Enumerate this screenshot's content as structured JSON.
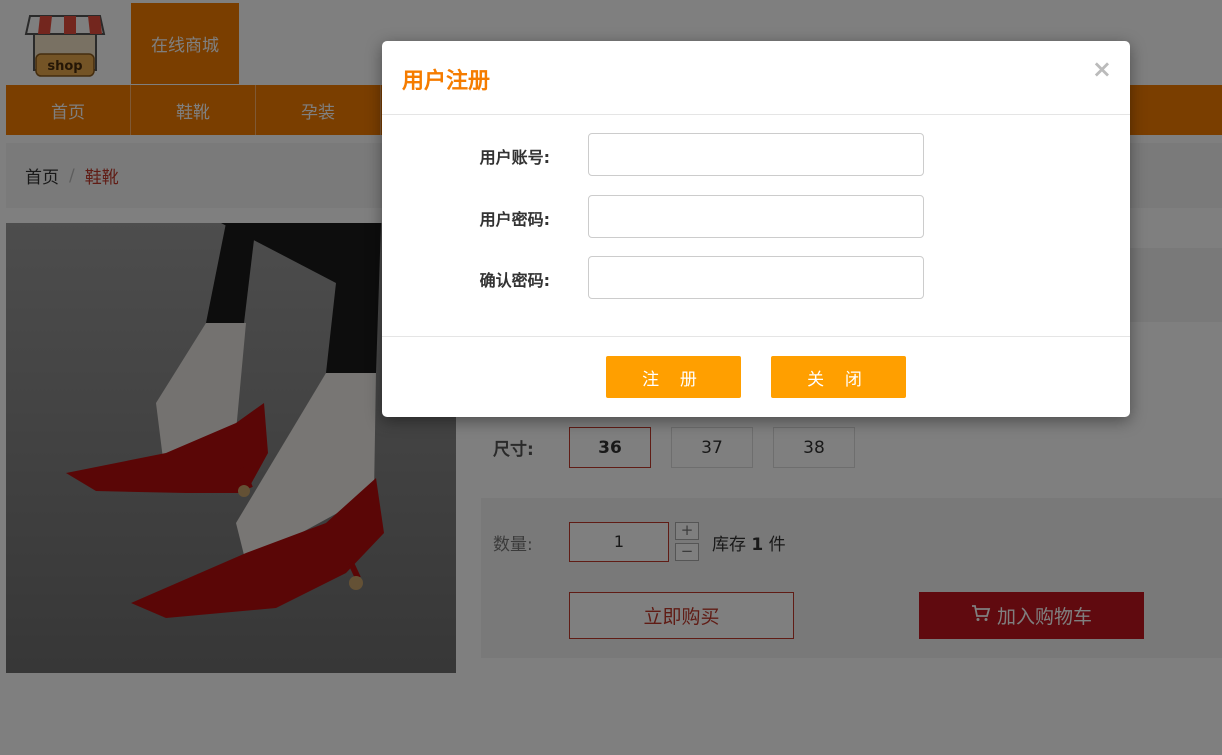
{
  "header": {
    "logo_text": "shop",
    "site_tab": "在线商城"
  },
  "nav": {
    "items": [
      "首页",
      "鞋靴",
      "孕装"
    ]
  },
  "breadcrumb": {
    "home": "首页",
    "separator": "/",
    "current": "鞋靴"
  },
  "product": {
    "size_label": "尺寸:",
    "sizes": [
      "36",
      "37",
      "38"
    ],
    "selected_size": "36",
    "qty_label": "数量:",
    "qty_value": "1",
    "qty_plus": "+",
    "qty_minus": "−",
    "stock_prefix": "库存",
    "stock_count": "1",
    "stock_suffix": "件",
    "buy_now": "立即购买",
    "add_to_cart": "加入购物车"
  },
  "modal": {
    "title": "用户注册",
    "close_symbol": "×",
    "fields": [
      {
        "label": "用户账号:",
        "value": ""
      },
      {
        "label": "用户密码:",
        "value": ""
      },
      {
        "label": "确认密码:",
        "value": ""
      }
    ],
    "register_button": "注 册",
    "close_button": "关 闭"
  },
  "colors": {
    "accent": "#f57c00",
    "button": "#ff9f00",
    "cart": "#c0141e",
    "overlay": "rgba(0,0,0,0.5)"
  }
}
